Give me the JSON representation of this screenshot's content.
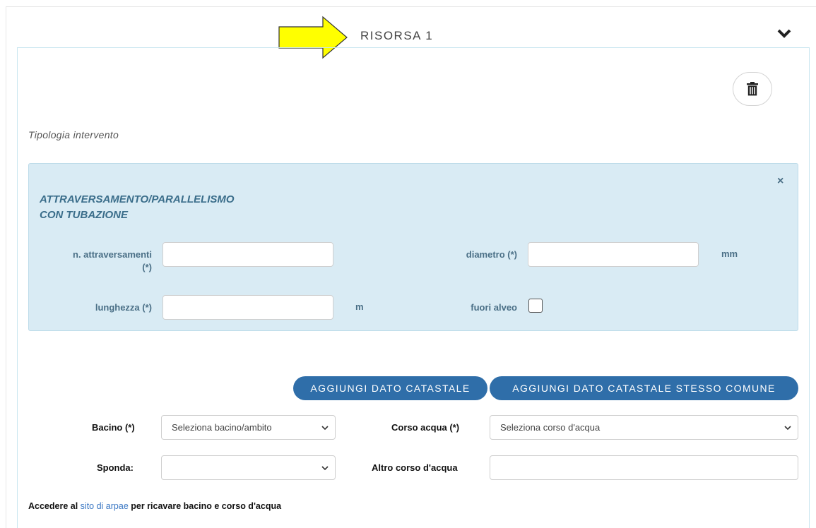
{
  "header": {
    "title": "RISORSA 1"
  },
  "section": {
    "type_label": "Tipologia intervento"
  },
  "intervention": {
    "title_line1": "ATTRAVERSAMENTO/PARALLELISMO",
    "title_line2": "CON TUBAZIONE",
    "close_label": "×",
    "fields": {
      "crossings_label_line1": "n. attraversamenti",
      "crossings_label_line2": "(*)",
      "crossings_value": "",
      "diameter_label": "diametro (*)",
      "diameter_value": "",
      "diameter_unit": "mm",
      "length_label": "lunghezza (*)",
      "length_value": "",
      "length_unit": "m",
      "out_of_bed_label": "fuori alveo",
      "out_of_bed_checked": false
    }
  },
  "buttons": {
    "add_cadastral": "AGGIUNGI DATO CATASTALE",
    "add_cadastral_same": "AGGIUNGI DATO CATASTALE STESSO COMUNE"
  },
  "form": {
    "basin_label": "Bacino (*)",
    "basin_selected": "Seleziona bacino/ambito",
    "watercourse_label": "Corso acqua (*)",
    "watercourse_selected": "Seleziona corso d'acqua",
    "bank_label": "Sponda:",
    "bank_selected": "",
    "other_watercourse_label": "Altro corso d'acqua",
    "other_watercourse_value": ""
  },
  "footer": {
    "prefix": "Accedere al ",
    "link_text": "sito di arpae",
    "suffix": " per ricavare bacino e corso d'acqua"
  },
  "icons": {
    "arrow": "arrow-right-icon",
    "collapse": "chevron-down-icon",
    "delete": "trash-icon",
    "close": "close-icon",
    "select_caret": "chevron-down-icon"
  },
  "colors": {
    "arrow_fill": "#ffff00",
    "box_background": "#d9ebf4",
    "accent_text": "#4a6f86",
    "button_blue": "#2f6ea9",
    "link_blue": "#3b78c4"
  }
}
